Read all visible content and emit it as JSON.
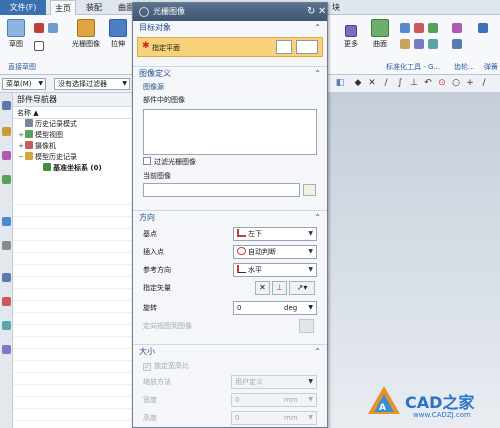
{
  "menubar": {
    "file": "文件(F)",
    "tabs": [
      "主页",
      "装配",
      "曲面"
    ],
    "right_tab": "块"
  },
  "ribbon": {
    "sketch_label": "草图",
    "group_direct_sketch": "直接草图",
    "raster_image_label": "光栅图像",
    "extrude_label": "拉伸",
    "more_label": "更多",
    "surface_label": "曲面",
    "group_std_tools": "标准化工具 - G...",
    "group_gear": "齿轮...",
    "group_spring": "弹簧"
  },
  "toolbar2": {
    "menu": "菜单(M)",
    "filter": "没有选择过滤器"
  },
  "navigator": {
    "title": "部件导航器",
    "column": "名称",
    "items": [
      {
        "label": "历史记录模式",
        "toggle": "",
        "bold": false
      },
      {
        "label": "模型视图",
        "toggle": "+",
        "bold": false
      },
      {
        "label": "摄像机",
        "toggle": "+",
        "bold": false
      },
      {
        "label": "模型历史记录",
        "toggle": "−",
        "bold": false
      },
      {
        "label": "基准坐标系 (0)",
        "toggle": "",
        "bold": true
      }
    ]
  },
  "dialog": {
    "title": "光栅图像",
    "target": {
      "header": "目标对象",
      "select_label": "指定平面"
    },
    "image_def": {
      "header": "图像定义",
      "source_sub": "图像源",
      "part_images_label": "部件中的图像",
      "filter_label": "过滤光栅图像",
      "current_label": "当前图像"
    },
    "orientation": {
      "header": "方向",
      "base_point_label": "基点",
      "base_point_value": "左下",
      "insert_label": "插入点",
      "insert_value": "自动判断",
      "ref_dir_label": "参考方向",
      "ref_dir_value": "水平",
      "vector_label": "指定矢量",
      "rotate_label": "旋转",
      "rotate_value": "0",
      "rotate_unit": "deg",
      "orient_view_label": "定向视图到图像"
    },
    "size": {
      "header": "大小",
      "lock_label": "锁定宽高比",
      "scale_label": "缩放方法",
      "scale_value": "用户定义",
      "width_label": "宽度",
      "width_value": "0",
      "width_unit": "mm",
      "height_label": "高度",
      "height_value": "0",
      "height_unit": "mm"
    }
  },
  "watermark": {
    "text": "CAD之家",
    "url": "www.CADZJ.com"
  },
  "colors": {
    "accent": "#3c6fb0",
    "selection_highlight": "#f7d27a",
    "section_header": "#1f4f8a"
  }
}
